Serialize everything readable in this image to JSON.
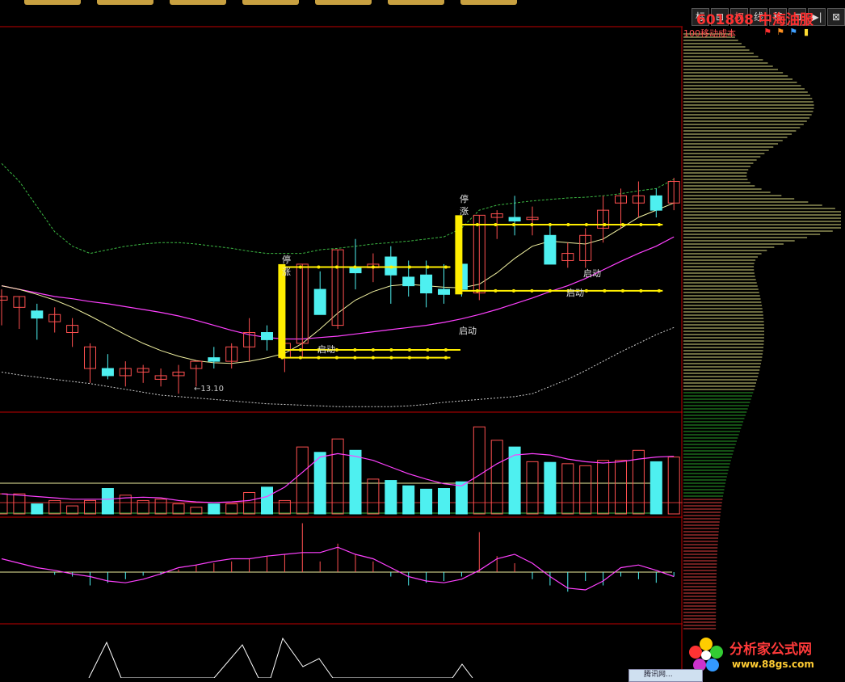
{
  "window": {
    "title_code": "601808",
    "title_name": "中海油服",
    "toolbar": [
      {
        "label": "标",
        "name": "mark"
      },
      {
        "label": "⊞",
        "name": "grid"
      },
      {
        "label": "权",
        "name": "rights"
      },
      {
        "label": "线",
        "name": "line"
      },
      {
        "label": "移",
        "name": "move"
      },
      {
        "label": "⊡",
        "name": "frame"
      },
      {
        "label": "▶|",
        "name": "play"
      },
      {
        "label": "⊠",
        "name": "close"
      }
    ],
    "cost_label": "100移动成本",
    "cost_icons": [
      "red-flag-icon",
      "orange-flag-icon",
      "blue-flag-icon",
      "yellow-doc-icon"
    ]
  },
  "colors": {
    "up": "#ff5050",
    "down": "#4ef0f0",
    "ma_short": "#f0f0a0",
    "ma_long": "#ff40ff",
    "band_upper": "#3cb843",
    "band_lower": "#cccccc",
    "signal": "#ffee00",
    "divider": "#c00000"
  },
  "annotations": {
    "low_label": "←13.10",
    "limit_up_1": "停涨",
    "limit_up_2": "停涨",
    "start_labels": [
      "启动",
      "启动",
      "启动",
      "启动"
    ]
  },
  "watermark": {
    "brand": "分析家公式网",
    "url": "www.88gs.com"
  },
  "taskbar_tip": "腾讯网...",
  "chart_data": [
    {
      "type": "candlestick",
      "title": "",
      "candles": [
        {
          "o": 14.4,
          "h": 14.55,
          "l": 14.05,
          "c": 14.45
        },
        {
          "o": 14.3,
          "h": 14.45,
          "l": 14.0,
          "c": 14.45
        },
        {
          "o": 14.25,
          "h": 14.35,
          "l": 13.85,
          "c": 14.15
        },
        {
          "o": 14.1,
          "h": 14.3,
          "l": 13.95,
          "c": 14.2
        },
        {
          "o": 13.95,
          "h": 14.15,
          "l": 13.75,
          "c": 14.05
        },
        {
          "o": 13.45,
          "h": 13.8,
          "l": 13.25,
          "c": 13.75
        },
        {
          "o": 13.45,
          "h": 13.65,
          "l": 13.3,
          "c": 13.35
        },
        {
          "o": 13.35,
          "h": 13.55,
          "l": 13.2,
          "c": 13.45
        },
        {
          "o": 13.4,
          "h": 13.5,
          "l": 13.25,
          "c": 13.45
        },
        {
          "o": 13.3,
          "h": 13.45,
          "l": 13.2,
          "c": 13.35
        },
        {
          "o": 13.35,
          "h": 13.5,
          "l": 13.1,
          "c": 13.4
        },
        {
          "o": 13.45,
          "h": 13.5,
          "l": 13.2,
          "c": 13.55
        },
        {
          "o": 13.6,
          "h": 13.75,
          "l": 13.45,
          "c": 13.55
        },
        {
          "o": 13.55,
          "h": 13.8,
          "l": 13.45,
          "c": 13.75
        },
        {
          "o": 13.75,
          "h": 14.15,
          "l": 13.55,
          "c": 13.95
        },
        {
          "o": 13.95,
          "h": 14.05,
          "l": 13.7,
          "c": 13.85
        },
        {
          "o": 13.6,
          "h": 13.95,
          "l": 13.4,
          "c": 13.8
        },
        {
          "o": 13.8,
          "h": 14.9,
          "l": 13.6,
          "c": 14.9
        },
        {
          "o": 14.55,
          "h": 14.8,
          "l": 14.25,
          "c": 14.2
        },
        {
          "o": 14.05,
          "h": 15.1,
          "l": 14.0,
          "c": 15.1
        },
        {
          "o": 14.85,
          "h": 15.25,
          "l": 14.55,
          "c": 14.78
        },
        {
          "o": 14.85,
          "h": 15.05,
          "l": 14.65,
          "c": 14.9
        },
        {
          "o": 15.0,
          "h": 15.15,
          "l": 14.35,
          "c": 14.75
        },
        {
          "o": 14.72,
          "h": 14.95,
          "l": 14.45,
          "c": 14.6
        },
        {
          "o": 14.75,
          "h": 14.95,
          "l": 14.3,
          "c": 14.5
        },
        {
          "o": 14.55,
          "h": 14.9,
          "l": 14.35,
          "c": 14.48
        },
        {
          "o": 14.9,
          "h": 15.0,
          "l": 14.45,
          "c": 14.55
        },
        {
          "o": 14.5,
          "h": 15.58,
          "l": 14.4,
          "c": 15.58
        },
        {
          "o": 15.55,
          "h": 15.65,
          "l": 15.25,
          "c": 15.6
        },
        {
          "o": 15.55,
          "h": 15.85,
          "l": 15.3,
          "c": 15.5
        },
        {
          "o": 15.52,
          "h": 15.7,
          "l": 15.3,
          "c": 15.55
        },
        {
          "o": 15.3,
          "h": 15.45,
          "l": 14.9,
          "c": 14.9
        },
        {
          "o": 14.95,
          "h": 15.2,
          "l": 14.85,
          "c": 15.05
        },
        {
          "o": 14.95,
          "h": 15.4,
          "l": 14.85,
          "c": 15.3
        },
        {
          "o": 15.4,
          "h": 15.85,
          "l": 15.2,
          "c": 15.65
        },
        {
          "o": 15.75,
          "h": 15.95,
          "l": 15.4,
          "c": 15.85
        },
        {
          "o": 15.75,
          "h": 16.05,
          "l": 15.55,
          "c": 15.85
        },
        {
          "o": 15.85,
          "h": 15.95,
          "l": 15.55,
          "c": 15.65
        },
        {
          "o": 15.75,
          "h": 16.1,
          "l": 15.65,
          "c": 16.05
        }
      ],
      "ma_short": [
        14.6,
        14.55,
        14.48,
        14.4,
        14.3,
        14.18,
        14.05,
        13.92,
        13.8,
        13.7,
        13.62,
        13.56,
        13.53,
        13.52,
        13.55,
        13.6,
        13.66,
        13.8,
        14.0,
        14.22,
        14.4,
        14.52,
        14.6,
        14.62,
        14.6,
        14.58,
        14.57,
        14.62,
        14.78,
        14.98,
        15.15,
        15.22,
        15.2,
        15.18,
        15.25,
        15.4,
        15.55,
        15.65,
        15.75
      ],
      "ma_long": [
        14.6,
        14.55,
        14.5,
        14.45,
        14.42,
        14.38,
        14.35,
        14.31,
        14.27,
        14.23,
        14.18,
        14.12,
        14.05,
        13.98,
        13.92,
        13.88,
        13.86,
        13.86,
        13.88,
        13.9,
        13.93,
        13.96,
        13.99,
        14.02,
        14.05,
        14.09,
        14.14,
        14.2,
        14.27,
        14.35,
        14.43,
        14.52,
        14.6,
        14.7,
        14.82,
        14.94,
        15.05,
        15.15,
        15.28
      ],
      "band_upper": [
        16.3,
        16.05,
        15.7,
        15.35,
        15.15,
        15.05,
        15.1,
        15.15,
        15.18,
        15.2,
        15.2,
        15.18,
        15.15,
        15.12,
        15.08,
        15.05,
        15.05,
        15.05,
        15.1,
        15.12,
        15.15,
        15.18,
        15.2,
        15.22,
        15.25,
        15.28,
        15.4,
        15.65,
        15.72,
        15.75,
        15.78,
        15.8,
        15.82,
        15.83,
        15.85,
        15.88,
        15.92,
        15.95,
        16.08
      ],
      "band_lower": [
        13.4,
        13.36,
        13.33,
        13.3,
        13.27,
        13.24,
        13.2,
        13.16,
        13.12,
        13.08,
        13.06,
        13.04,
        13.02,
        13.0,
        12.98,
        12.96,
        12.95,
        12.94,
        12.93,
        12.92,
        12.92,
        12.92,
        12.92,
        12.93,
        12.95,
        12.98,
        13.0,
        13.02,
        13.04,
        13.06,
        13.1,
        13.2,
        13.3,
        13.42,
        13.55,
        13.68,
        13.8,
        13.92,
        14.02
      ],
      "low_marker": {
        "index": 10,
        "price": 13.1
      },
      "signals": [
        {
          "limit_up_index": 16,
          "top": 14.9,
          "bottom": 13.6,
          "upper_line": 14.86,
          "lower_line": 13.6,
          "start_index": 16,
          "end_index": 25
        },
        {
          "limit_up_index": 26,
          "top": 15.58,
          "bottom": 14.48,
          "upper_line": 15.45,
          "lower_line": 14.53,
          "start_index": 26,
          "end_index": 37
        }
      ]
    },
    {
      "type": "bar",
      "title": "Volume",
      "values": [
        30,
        30,
        15,
        20,
        12,
        20,
        38,
        28,
        20,
        22,
        15,
        10,
        15,
        15,
        32,
        40,
        20,
        100,
        92,
        112,
        95,
        52,
        50,
        42,
        37,
        38,
        48,
        130,
        110,
        100,
        78,
        77,
        75,
        72,
        80,
        80,
        95,
        78,
        85
      ],
      "ma": [
        30,
        28,
        26,
        24,
        22,
        22,
        22,
        24,
        25,
        24,
        20,
        18,
        17,
        18,
        20,
        26,
        40,
        62,
        85,
        90,
        86,
        80,
        70,
        60,
        52,
        45,
        42,
        58,
        75,
        88,
        90,
        88,
        82,
        78,
        76,
        78,
        82,
        85,
        86
      ],
      "ylim": [
        0,
        140
      ]
    },
    {
      "type": "bar",
      "title": "Oscillator",
      "values": [
        0,
        0,
        0,
        -3,
        -5,
        -15,
        -12,
        -8,
        -4,
        -3,
        3,
        8,
        10,
        12,
        15,
        18,
        20,
        55,
        12,
        32,
        20,
        12,
        -5,
        -15,
        -12,
        -10,
        -5,
        45,
        18,
        10,
        -8,
        -15,
        -22,
        -10,
        -15,
        -5,
        -8,
        -12,
        -5
      ],
      "line": [
        15,
        10,
        5,
        2,
        -2,
        -5,
        -10,
        -12,
        -8,
        -2,
        5,
        8,
        12,
        15,
        15,
        18,
        20,
        22,
        22,
        28,
        20,
        15,
        5,
        -5,
        -10,
        -12,
        -8,
        2,
        15,
        20,
        10,
        -5,
        -18,
        -20,
        -10,
        5,
        8,
        2,
        -5
      ],
      "ylim": [
        -40,
        60
      ]
    }
  ]
}
